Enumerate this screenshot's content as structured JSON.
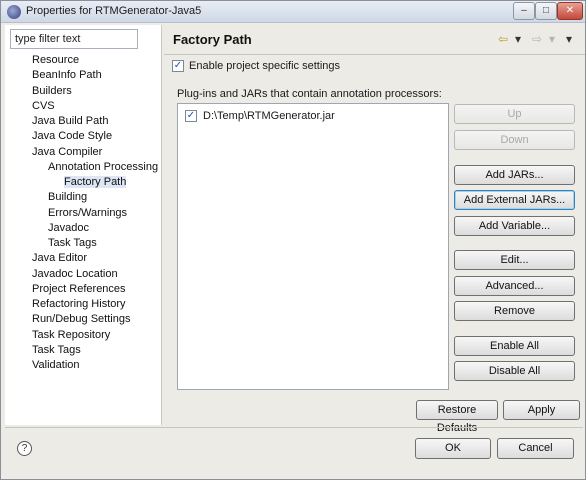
{
  "window": {
    "title": "Properties for RTMGenerator-Java5",
    "controls": {
      "minimize": "–",
      "maximize": "□",
      "close": "✕"
    }
  },
  "sidebar": {
    "filter_value": "type filter text",
    "items": [
      {
        "label": "Resource",
        "level": 0
      },
      {
        "label": "BeanInfo Path",
        "level": 0
      },
      {
        "label": "Builders",
        "level": 0
      },
      {
        "label": "CVS",
        "level": 0
      },
      {
        "label": "Java Build Path",
        "level": 0
      },
      {
        "label": "Java Code Style",
        "level": 0
      },
      {
        "label": "Java Compiler",
        "level": 0
      },
      {
        "label": "Annotation Processing",
        "level": 1
      },
      {
        "label": "Factory Path",
        "level": 2,
        "selected": true
      },
      {
        "label": "Building",
        "level": 1
      },
      {
        "label": "Errors/Warnings",
        "level": 1
      },
      {
        "label": "Javadoc",
        "level": 1
      },
      {
        "label": "Task Tags",
        "level": 1
      },
      {
        "label": "Java Editor",
        "level": 0
      },
      {
        "label": "Javadoc Location",
        "level": 0
      },
      {
        "label": "Project References",
        "level": 0
      },
      {
        "label": "Refactoring History",
        "level": 0
      },
      {
        "label": "Run/Debug Settings",
        "level": 0
      },
      {
        "label": "Task Repository",
        "level": 0
      },
      {
        "label": "Task Tags",
        "level": 0
      },
      {
        "label": "Validation",
        "level": 0
      }
    ]
  },
  "page": {
    "title": "Factory Path",
    "nav": {
      "back": "⇦",
      "forward": "⇨",
      "dropdown": "▾",
      "menu": "▾"
    },
    "enable_label": "Enable project specific settings",
    "enable_checked": true,
    "list_label": "Plug-ins and JARs that contain annotation processors:",
    "jars": [
      {
        "path": "D:\\Temp\\RTMGenerator.jar",
        "checked": true
      }
    ],
    "buttons": {
      "up": "Up",
      "down": "Down",
      "add_jars": "Add JARs...",
      "add_external_jars": "Add External JARs...",
      "add_variable": "Add Variable...",
      "edit": "Edit...",
      "advanced": "Advanced...",
      "remove": "Remove",
      "enable_all": "Enable All",
      "disable_all": "Disable All"
    },
    "restore_defaults": "Restore Defaults",
    "apply": "Apply"
  },
  "footer": {
    "help": "?",
    "ok": "OK",
    "cancel": "Cancel"
  },
  "colors": {
    "selection": "#dde6f3",
    "focus_border": "#3c7fb1"
  }
}
